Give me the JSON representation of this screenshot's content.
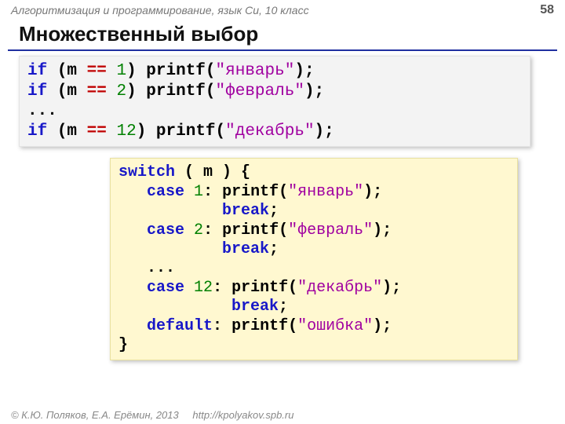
{
  "header": {
    "course": "Алгоритмизация и программирование, язык Си, 10 класс",
    "page": "58"
  },
  "title": "Множественный выбор",
  "code1": {
    "l1": {
      "kw": "if",
      "op": "==",
      "num": "1",
      "fn": "printf(",
      "str": "\"январь\"",
      "tail": ");",
      "m": "(m ",
      "close": ") "
    },
    "l2": {
      "kw": "if",
      "op": "==",
      "num": "2",
      "fn": "printf(",
      "str": "\"февраль\"",
      "tail": ");",
      "m": "(m ",
      "close": ") "
    },
    "dots": "...",
    "l3": {
      "kw": "if",
      "op": "==",
      "num": "12",
      "fn": "printf(",
      "str": "\"декабрь\"",
      "tail": ");",
      "m": "(m ",
      "close": ") "
    }
  },
  "code2": {
    "switch": "switch",
    "switch_tail": " ( m ) { ",
    "case": "case",
    "break": "break",
    "default": "default",
    "printf": "printf(",
    "semi": ";",
    "colon": ":",
    "close_paren": ")",
    "brace_close": "}",
    "dots": "   ...",
    "n1": "1",
    "s1": "\"январь\"",
    "n2": "2",
    "s2": "\"февраль\"",
    "n3": "12",
    "s3": "\"декабрь\"",
    "s4": "\"ошибка\""
  },
  "footer": {
    "copyright": "© К.Ю. Поляков, Е.А. Ерёмин, 2013",
    "url": "http://kpolyakov.spb.ru"
  }
}
